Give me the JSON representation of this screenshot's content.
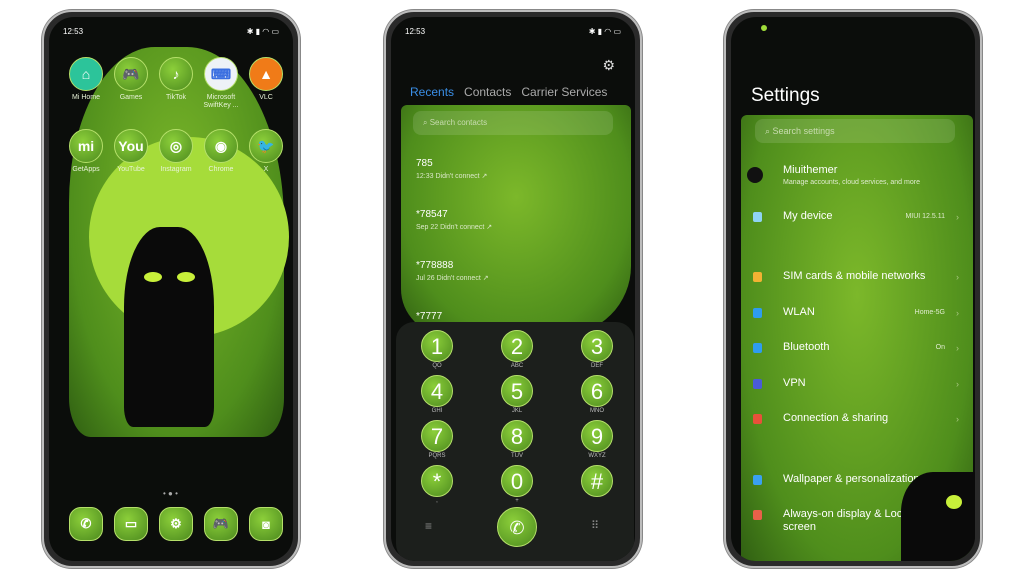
{
  "status": {
    "time": "12:53"
  },
  "home": {
    "apps": [
      {
        "label": "Mi Home",
        "glyph": "⌂",
        "color": "#2cc49a"
      },
      {
        "label": "Games",
        "glyph": "🎮"
      },
      {
        "label": "TikTok",
        "glyph": "♪"
      },
      {
        "label": "Microsoft SwiftKey ...",
        "glyph": "⌨",
        "color": "#eef2f7"
      },
      {
        "label": "VLC",
        "glyph": "▲",
        "color": "#f07b18"
      },
      {
        "label": "GetApps",
        "glyph": "mi"
      },
      {
        "label": "YouTube",
        "glyph": "You"
      },
      {
        "label": "Instagram",
        "glyph": "◎"
      },
      {
        "label": "Chrome",
        "glyph": "◉"
      },
      {
        "label": "X",
        "glyph": "🐦"
      }
    ],
    "dock": [
      {
        "name": "phone",
        "glyph": "✆"
      },
      {
        "name": "messages",
        "glyph": "▭"
      },
      {
        "name": "settings",
        "glyph": "⚙"
      },
      {
        "name": "games",
        "glyph": "🎮"
      },
      {
        "name": "camera",
        "glyph": "◙"
      }
    ]
  },
  "dialer": {
    "tabs": [
      "Recents",
      "Contacts",
      "Carrier Services"
    ],
    "search_placeholder": "Search contacts",
    "calls": [
      {
        "number": "785",
        "detail": "12:33 Didn't connect ↗"
      },
      {
        "number": "*78547",
        "detail": "Sep 22 Didn't connect ↗"
      },
      {
        "number": "*778888",
        "detail": "Jul 26 Didn't connect ↗"
      },
      {
        "number": "*7777",
        "detail": ""
      }
    ],
    "keys": [
      {
        "d": "1",
        "l": "QO"
      },
      {
        "d": "2",
        "l": "ABC"
      },
      {
        "d": "3",
        "l": "DEF"
      },
      {
        "d": "4",
        "l": "GHI"
      },
      {
        "d": "5",
        "l": "JKL"
      },
      {
        "d": "6",
        "l": "MNO"
      },
      {
        "d": "7",
        "l": "PQRS"
      },
      {
        "d": "8",
        "l": "TUV"
      },
      {
        "d": "9",
        "l": "WXYZ"
      },
      {
        "d": "*",
        "l": ","
      },
      {
        "d": "0",
        "l": "+"
      },
      {
        "d": "#",
        "l": ""
      }
    ]
  },
  "settings": {
    "title": "Settings",
    "search_placeholder": "Search settings",
    "account": {
      "label": "Miuithemer",
      "sub": "Manage accounts, cloud services, and more"
    },
    "items": [
      {
        "label": "My device",
        "value": "MIUI 12.5.11",
        "color": "#8fd3f4"
      },
      {
        "label": "SIM cards & mobile networks",
        "value": "",
        "color": "#f2b233"
      },
      {
        "label": "WLAN",
        "value": "Home-5G",
        "color": "#2e9cf0"
      },
      {
        "label": "Bluetooth",
        "value": "On",
        "color": "#2e9cf0"
      },
      {
        "label": "VPN",
        "value": "",
        "color": "#4a5bd8"
      },
      {
        "label": "Connection & sharing",
        "value": "",
        "color": "#e8503a"
      },
      {
        "label": "Wallpaper & personalization",
        "value": "",
        "color": "#3aa0f0"
      },
      {
        "label": "Always-on display & Lock screen",
        "value": "",
        "color": "#e8604a"
      }
    ]
  },
  "colors": {
    "accent": "#3a8ee6",
    "theme_green": "#6cab26"
  }
}
